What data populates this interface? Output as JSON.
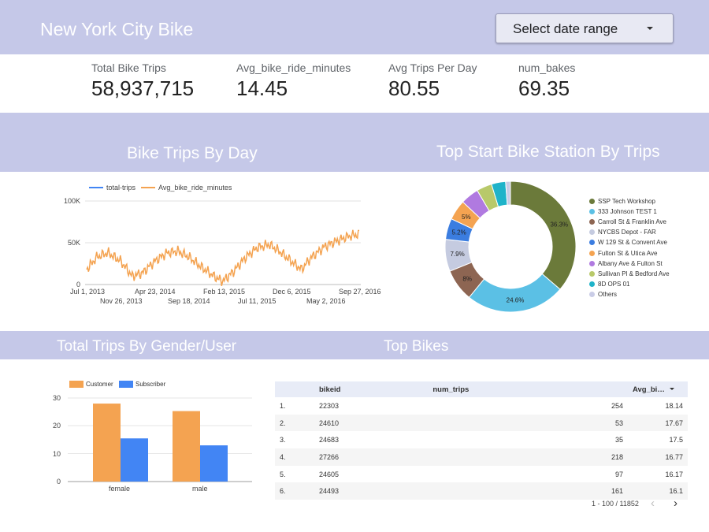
{
  "header": {
    "title": "New York City Bike",
    "date_range_label": "Select date range"
  },
  "kpis": [
    {
      "label": "Total Bike Trips",
      "value": "58,937,715"
    },
    {
      "label": "Avg_bike_ride_minutes",
      "value": "14.45"
    },
    {
      "label": "Avg Trips Per Day",
      "value": "80.55"
    },
    {
      "label": "num_bakes",
      "value": "69.35"
    }
  ],
  "colors": {
    "band": "#c5c8e8",
    "blue": "#4285f4",
    "orange": "#f4a351"
  },
  "sections": {
    "trips_by_day": "Bike Trips By Day",
    "top_stations": "Top Start Bike Station By Trips",
    "gender": "Total Trips By Gender/User",
    "top_bikes": "Top Bikes"
  },
  "chart_data": [
    {
      "type": "line",
      "legend": [
        "total-trips",
        "Avg_bike_ride_minutes"
      ],
      "y_ticks": [
        "100K",
        "50K",
        "0"
      ],
      "ylim": [
        0,
        100000
      ],
      "x_ticks_top": [
        "Jul 1, 2013",
        "Apr 23, 2014",
        "Feb 13, 2015",
        "Dec 6, 2015",
        "Sep 27, 2016"
      ],
      "x_ticks_bottom": [
        "Nov 26, 2013",
        "Sep 18, 2014",
        "Jul 11, 2015",
        "May 2, 2016"
      ],
      "series": [
        {
          "name": "Avg_bike_ride_minutes",
          "color": "#f4a351",
          "x": [
            "2013-07-01",
            "2013-08-15",
            "2013-10-01",
            "2013-11-26",
            "2014-01-15",
            "2014-03-01",
            "2014-04-23",
            "2014-06-15",
            "2014-08-01",
            "2014-09-18",
            "2014-11-15",
            "2015-01-15",
            "2015-02-13",
            "2015-04-01",
            "2015-05-20",
            "2015-07-11",
            "2015-09-01",
            "2015-10-15",
            "2015-12-06",
            "2016-01-20",
            "2016-03-01",
            "2016-05-02",
            "2016-06-20",
            "2016-08-15",
            "2016-09-27"
          ],
          "y": [
            18000,
            33000,
            38000,
            28000,
            10000,
            14000,
            28000,
            38000,
            40000,
            33000,
            20000,
            8000,
            4000,
            16000,
            32000,
            44000,
            48000,
            40000,
            28000,
            18000,
            32000,
            46000,
            52000,
            58000,
            60000
          ]
        }
      ]
    },
    {
      "type": "pie",
      "labels": [
        "SSP Tech Workshop",
        "333 Johnson TEST 1",
        "Carroll St & Franklin Ave",
        "NYCBS Depot - FAR",
        "W 129 St & Convent Ave",
        "Fulton St & Utica Ave",
        "Albany Ave & Fulton St",
        "Sullivan Pl & Bedford Ave",
        "8D OPS 01",
        "Others"
      ],
      "values": [
        36.3,
        24.6,
        8,
        7.9,
        5.2,
        5,
        4.5,
        3.8,
        3.5,
        1.2
      ],
      "data_labels": [
        "36.3%",
        "24.6%",
        "8%",
        "7.9%",
        "5.2%",
        "5%",
        "",
        "",
        "",
        ""
      ],
      "colors": [
        "#6b7a3a",
        "#5bc0e5",
        "#8d6552",
        "#c5cbe0",
        "#3b7de0",
        "#f4a351",
        "#b07ae0",
        "#b8c96a",
        "#1fb3c9",
        "#c9cce6"
      ]
    },
    {
      "type": "bar",
      "categories": [
        "female",
        "male"
      ],
      "series": [
        {
          "name": "Customer",
          "values": [
            28,
            25.3
          ],
          "color": "#f4a351"
        },
        {
          "name": "Subscriber",
          "values": [
            15.5,
            13
          ],
          "color": "#4285f4"
        }
      ],
      "y_ticks": [
        "30",
        "20",
        "10",
        "0"
      ],
      "ylim": [
        0,
        35
      ]
    },
    {
      "type": "table",
      "columns": [
        "bikeid",
        "num_trips",
        "Avg_bi…"
      ],
      "rows": [
        [
          "1.",
          "22303",
          "254",
          "18.14"
        ],
        [
          "2.",
          "24610",
          "53",
          "17.67"
        ],
        [
          "3.",
          "24683",
          "35",
          "17.5"
        ],
        [
          "4.",
          "27266",
          "218",
          "16.77"
        ],
        [
          "5.",
          "24605",
          "97",
          "16.17"
        ],
        [
          "6.",
          "24493",
          "161",
          "16.1"
        ]
      ],
      "pager": "1 - 100 / 11852"
    }
  ]
}
